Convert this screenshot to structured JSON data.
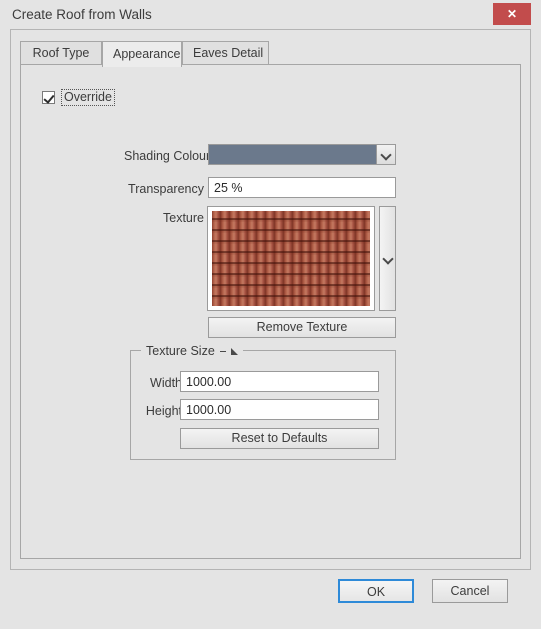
{
  "window": {
    "title": "Create Roof from Walls",
    "close_label": "✕"
  },
  "tabs": [
    {
      "label": "Roof Type",
      "active": false
    },
    {
      "label": "Appearance",
      "active": true
    },
    {
      "label": "Eaves Detail",
      "active": false
    }
  ],
  "appearance": {
    "override": {
      "label": "Override",
      "checked": true
    },
    "shading_colour": {
      "label": "Shading Colour",
      "swatch_color": "#6b798c",
      "arrow_icon": "chevron-down-icon"
    },
    "transparency": {
      "label": "Transparency",
      "value": "25 %",
      "placeholder": ""
    },
    "texture": {
      "label": "Texture",
      "preview_name": "clay-roof-tile-texture",
      "base_color": "#a54f3c",
      "dropdown_icon": "chevron-down-icon",
      "remove_button_label": "Remove Texture"
    },
    "texture_size": {
      "legend": "Texture Size",
      "link_icon": "aspect-ratio-link-icon",
      "width_label": "Width",
      "width_value": "1000.00",
      "height_label": "Height",
      "height_value": "1000.00",
      "reset_button_label": "Reset to Defaults"
    }
  },
  "footer": {
    "ok_label": "OK",
    "cancel_label": "Cancel"
  }
}
